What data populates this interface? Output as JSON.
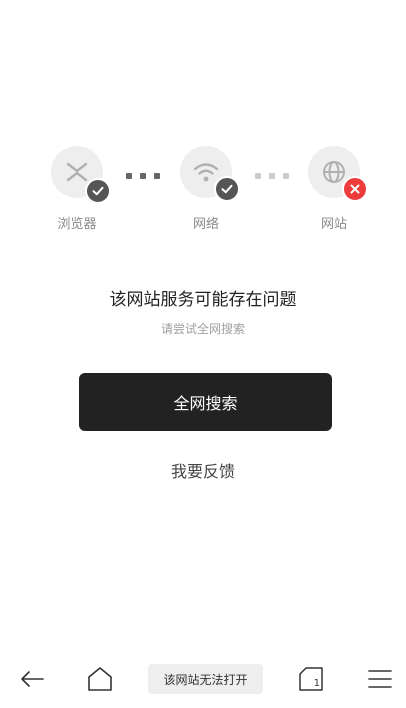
{
  "diagnostics": {
    "nodes": [
      {
        "label": "浏览器",
        "status": "ok"
      },
      {
        "label": "网络",
        "status": "ok"
      },
      {
        "label": "网站",
        "status": "fail"
      }
    ]
  },
  "message": {
    "title": "该网站服务可能存在问题",
    "subtitle": "请尝试全网搜索"
  },
  "actions": {
    "search_label": "全网搜索",
    "feedback_label": "我要反馈"
  },
  "bottom_bar": {
    "status_text": "该网站无法打开",
    "tab_count": "1"
  },
  "colors": {
    "ok_badge": "#555555",
    "fail_badge": "#ee3b3b",
    "primary_button": "#222222"
  }
}
